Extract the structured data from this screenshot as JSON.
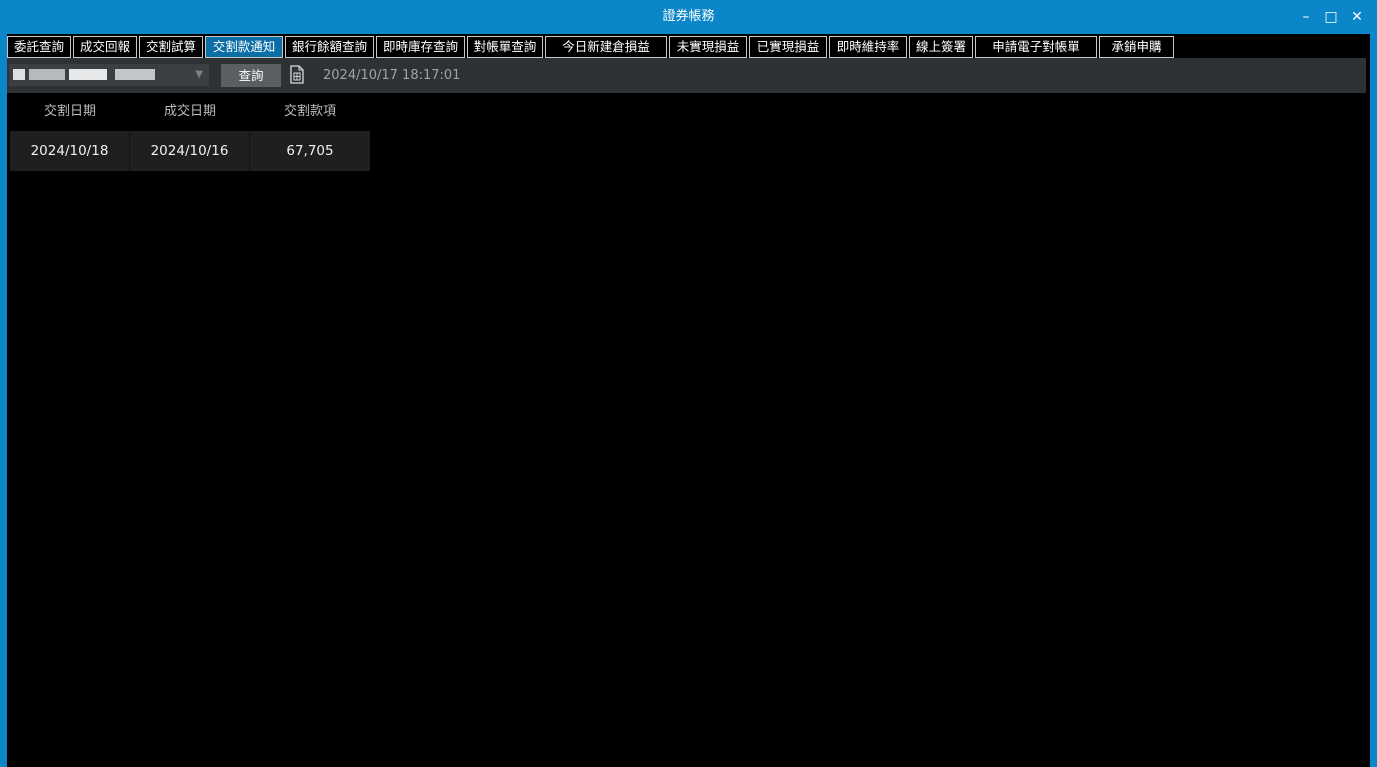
{
  "window": {
    "title": "證券帳務",
    "controls": {
      "minimize": "–",
      "maximize": "□",
      "close": "✕"
    }
  },
  "tabs": [
    {
      "label": "委託查詢",
      "active": false
    },
    {
      "label": "成交回報",
      "active": false
    },
    {
      "label": "交割試算",
      "active": false
    },
    {
      "label": "交割款通知",
      "active": true
    },
    {
      "label": "銀行餘額查詢",
      "active": false
    },
    {
      "label": "即時庫存查詢",
      "active": false
    },
    {
      "label": "對帳單查詢",
      "active": false
    },
    {
      "label": "今日新建倉損益",
      "active": false
    },
    {
      "label": "未實現損益",
      "active": false
    },
    {
      "label": "已實現損益",
      "active": false
    },
    {
      "label": "即時維持率",
      "active": false
    },
    {
      "label": "線上簽署",
      "active": false
    },
    {
      "label": "申請電子對帳單",
      "active": false
    },
    {
      "label": "承銷申購",
      "active": false
    }
  ],
  "toolbar": {
    "account_value": "",
    "query_label": "查詢",
    "export_icon": "excel-export-icon",
    "timestamp": "2024/10/17  18:17:01"
  },
  "table": {
    "columns": [
      "交割日期",
      "成交日期",
      "交割款項"
    ],
    "rows": [
      [
        "2024/10/18",
        "2024/10/16",
        "67,705"
      ]
    ]
  },
  "colors": {
    "title_bar": "#0b86c8",
    "active_tab": "#0c6ea6",
    "background": "#000000",
    "toolbar": "#2f3234",
    "button": "#5b5f63"
  }
}
